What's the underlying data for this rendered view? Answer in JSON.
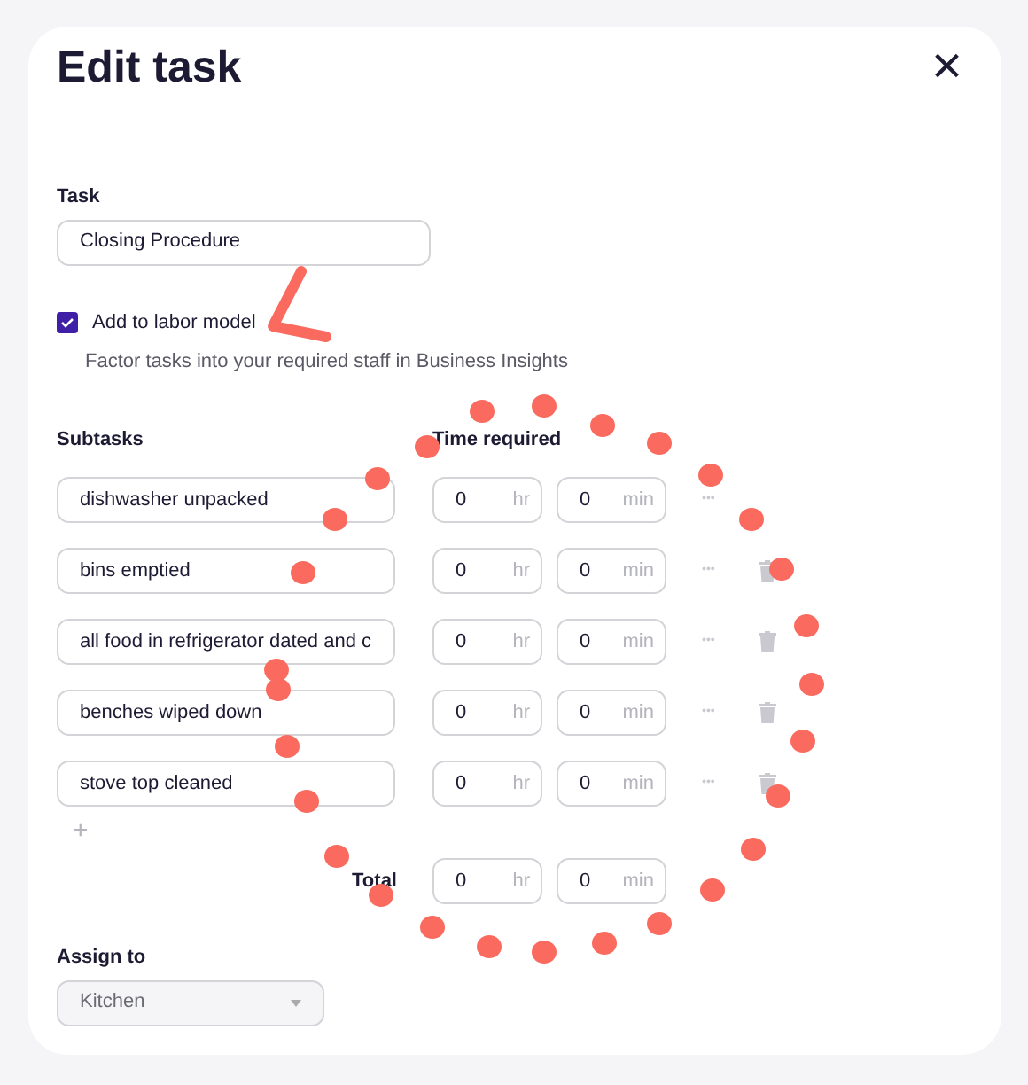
{
  "dialog": {
    "title": "Edit task",
    "close": "×"
  },
  "task": {
    "label": "Task",
    "value": "Closing Procedure"
  },
  "labor_model": {
    "label": "Add to labor model",
    "checked": true,
    "help": "Factor tasks into your required staff in Business Insights"
  },
  "subtasks": {
    "label": "Subtasks",
    "time_label": "Time required",
    "rows": [
      {
        "name": "dishwasher unpacked",
        "hours": "0",
        "hr_unit": "hr",
        "minutes": "0",
        "min_unit": "min",
        "more": "•••",
        "deletable": false
      },
      {
        "name": "bins emptied",
        "hours": "0",
        "hr_unit": "hr",
        "minutes": "0",
        "min_unit": "min",
        "more": "•••",
        "deletable": true
      },
      {
        "name": "all food in refrigerator dated and c",
        "hours": "0",
        "hr_unit": "hr",
        "minutes": "0",
        "min_unit": "min",
        "more": "•••",
        "deletable": true
      },
      {
        "name": "benches wiped down",
        "hours": "0",
        "hr_unit": "hr",
        "minutes": "0",
        "min_unit": "min",
        "more": "•••",
        "deletable": true
      },
      {
        "name": "stove top cleaned",
        "hours": "0",
        "hr_unit": "hr",
        "minutes": "0",
        "min_unit": "min",
        "more": "•••",
        "deletable": true
      }
    ],
    "add": "+",
    "total_label": "Total",
    "total_hours": "0",
    "total_minutes": "0",
    "hr_unit": "hr",
    "min_unit": "min"
  },
  "assign": {
    "label": "Assign to",
    "value": "Kitchen"
  }
}
